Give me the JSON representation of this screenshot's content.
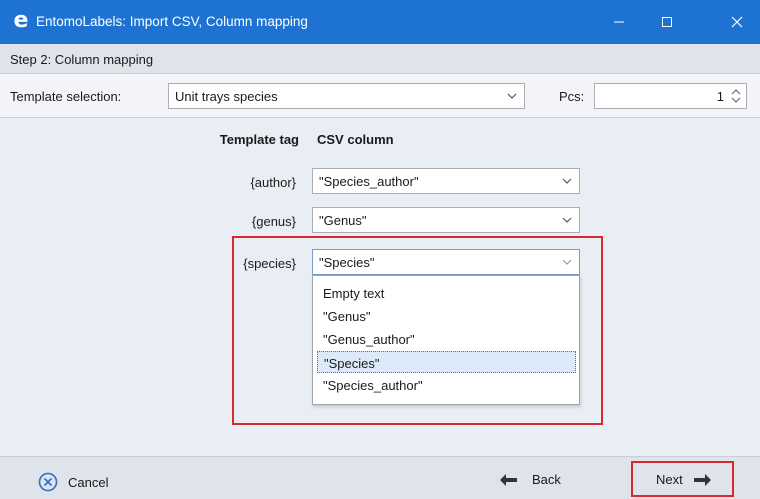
{
  "window": {
    "title": "EntomoLabels: Import CSV, Column mapping",
    "app_icon_glyph": "e",
    "accent": "#1e73d2"
  },
  "step": {
    "label": "Step 2: Column mapping"
  },
  "template": {
    "label": "Template selection:",
    "value": "Unit trays species",
    "pcs_label": "Pcs:",
    "pcs_value": "1"
  },
  "mapping": {
    "header_tag": "Template tag",
    "header_column": "CSV column",
    "rows": [
      {
        "tag": "{author}",
        "column": "\"Species_author\""
      },
      {
        "tag": "{genus}",
        "column": "\"Genus\""
      },
      {
        "tag": "{species}",
        "column": "\"Species\""
      }
    ]
  },
  "dropdown": {
    "items": [
      "Empty text",
      "\"Genus\"",
      "\"Genus_author\"",
      "\"Species\"",
      "\"Species_author\""
    ],
    "selected": "\"Species\""
  },
  "footer": {
    "cancel": "Cancel",
    "back": "Back",
    "next": "Next"
  },
  "colors": {
    "highlight": "#d9282e",
    "selection": "#dbe9f9"
  }
}
